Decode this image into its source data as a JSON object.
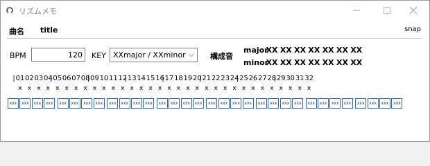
{
  "window": {
    "title": "リズムメモ"
  },
  "song": {
    "label": "曲名",
    "title": "title"
  },
  "snap_label": "snap",
  "bpm": {
    "label": "BPM",
    "value": "120"
  },
  "key": {
    "label": "KEY",
    "selected": "XXmajor / XXminor"
  },
  "chords": {
    "label": "構成音",
    "major_label": "major",
    "minor_label": "minor",
    "major": [
      "XX",
      "XX",
      "XX",
      "XX",
      "XX",
      "XX",
      "XX"
    ],
    "minor": [
      "XX",
      "XX",
      "XX",
      "XX",
      "XX",
      "XX",
      "XX"
    ]
  },
  "beats": [
    "01",
    "02",
    "03",
    "04",
    "05",
    "06",
    "07",
    "08",
    "09",
    "10",
    "11",
    "12",
    "13",
    "14",
    "15",
    "16",
    "17",
    "18",
    "19",
    "20",
    "21",
    "22",
    "23",
    "24",
    "25",
    "26",
    "27",
    "28",
    "29",
    "30",
    "31",
    "32"
  ],
  "bar_separator": "|",
  "beat_mark": "x",
  "cell_text": "xxx",
  "accent_color": "#1e6ec8"
}
